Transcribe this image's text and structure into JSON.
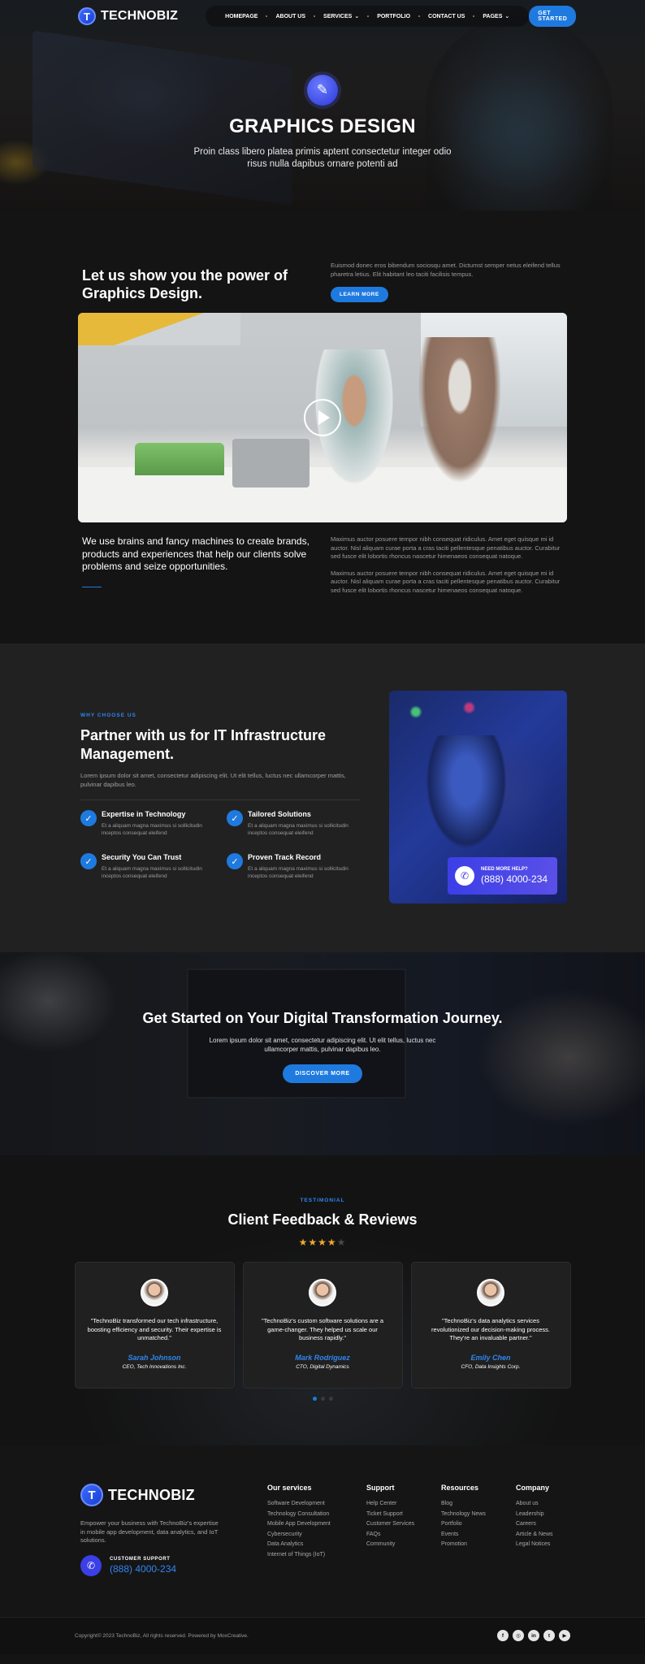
{
  "nav": {
    "logo_text": "TECHNOBIZ",
    "logo_mark": "T",
    "items": [
      {
        "label": "HOMEPAGE",
        "has_dropdown": false
      },
      {
        "label": "ABOUT US",
        "has_dropdown": false
      },
      {
        "label": "SERVICES",
        "has_dropdown": true
      },
      {
        "label": "PORTFOLIO",
        "has_dropdown": false
      },
      {
        "label": "CONTACT US",
        "has_dropdown": false
      },
      {
        "label": "PAGES",
        "has_dropdown": true
      }
    ],
    "cta": "GET STARTED"
  },
  "hero": {
    "icon": "design-tools-icon",
    "title": "GRAPHICS DESIGN",
    "subtitle": "Proin class libero platea primis aptent consectetur integer odio risus nulla dapibus ornare potenti ad"
  },
  "power": {
    "heading": "Let us show you the power of Graphics Design.",
    "intro": "Euismod donec eros bibendum sociosqu amet. Dictumst semper netus eleifend tellus pharetra letius. Elit habitant leo taciti facilisis tempus.",
    "button": "LEARN MORE",
    "lead": "We use brains and fancy machines to create brands, products and experiences that help our clients solve problems and seize opportunities.",
    "paragraphs": [
      "Maximus auctor posuere tempor nibh consequat ridiculus. Amet eget quisque mi id auctor. Nisl aliquam curae porta a cras taciti pellentesque penatibus auctor. Curabitur sed fusce elit lobortis rhoncus nascetur himenaeos consequat natoque.",
      "Maximus auctor posuere tempor nibh consequat ridiculus. Amet eget quisque mi id auctor. Nisl aliquam curae porta a cras taciti pellentesque penatibus auctor. Curabitur sed fusce elit lobortis rhoncus nascetur himenaeos consequat natoque."
    ]
  },
  "why": {
    "eyebrow": "WHY CHOOSE US",
    "title": "Partner with us for IT Infrastructure Management.",
    "description": "Lorem ipsum dolor sit amet, consectetur adipiscing elit. Ut elit tellus, luctus nec ullamcorper mattis, pulvinar dapibus leo.",
    "features": [
      {
        "title": "Expertise in Technology",
        "text": "Et a aliquam magna maximus si sollicitudin inceptos consequat eleifend"
      },
      {
        "title": "Tailored Solutions",
        "text": "Et a aliquam magna maximus si sollicitudin inceptos consequat eleifend"
      },
      {
        "title": "Security You Can Trust",
        "text": "Et a aliquam magna maximus si sollicitudin inceptos consequat eleifend"
      },
      {
        "title": "Proven Track Record",
        "text": "Et a aliquam magna maximus si sollicitudin inceptos consequat eleifend"
      }
    ],
    "help_label": "NEED MORE HELP?",
    "help_phone": "(888) 4000-234"
  },
  "cta": {
    "title": "Get Started on Your Digital Transformation Journey.",
    "description": "Lorem ipsum dolor sit amet, consectetur adipiscing elit. Ut elit tellus, luctus nec ullamcorper mattis, pulvinar dapibus leo.",
    "button": "DISCOVER MORE"
  },
  "testimonials": {
    "eyebrow": "TESTIMONIAL",
    "title": "Client Feedback & Reviews",
    "rating": 4,
    "rating_max": 5,
    "items": [
      {
        "quote": "\"TechnoBiz transformed our tech infrastructure, boosting efficiency and security. Their expertise is unmatched.\"",
        "name": "Sarah Johnson",
        "role": "CEO, Tech Innovations Inc."
      },
      {
        "quote": "\"TechnoBiz's custom software solutions are a game-changer. They helped us scale our business rapidly.\"",
        "name": "Mark Rodriguez",
        "role": "CTO, Digital Dynamics"
      },
      {
        "quote": "\"TechnoBiz's data analytics services revolutionized our decision-making process. They're an invaluable partner.\"",
        "name": "Emily Chen",
        "role": "CFO, Data Insights Corp."
      }
    ],
    "pagination_pages": 3,
    "pagination_active": 1
  },
  "footer": {
    "logo_text": "TECHNOBIZ",
    "about": "Empower your business with TechnoBiz's expertise in mobile app development, data analytics, and IoT solutions.",
    "support_label": "CUSTOMER SUPPORT",
    "support_phone": "(888) 4000-234",
    "columns": [
      {
        "title": "Our services",
        "links": [
          "Software Development",
          "Technology Consultation",
          "Mobile App Development",
          "Cybersecurity",
          "Data Analytics",
          "Internet of Things (IoT)"
        ]
      },
      {
        "title": "Support",
        "links": [
          "Help Center",
          "Ticket Support",
          "Customer Services",
          "FAQs",
          "Community"
        ]
      },
      {
        "title": "Resources",
        "links": [
          "Blog",
          "Technology News",
          "Portfolio",
          "Events",
          "Promotion"
        ]
      },
      {
        "title": "Company",
        "links": [
          "About us",
          "Leadership",
          "Careers",
          "Article & News",
          "Legal Notices"
        ]
      }
    ],
    "copyright": "Copyright© 2023 TechnoBiz, All rights reserved. Powered by MoxCreative.",
    "socials": [
      {
        "icon": "facebook-icon",
        "glyph": "f"
      },
      {
        "icon": "instagram-icon",
        "glyph": "◎"
      },
      {
        "icon": "linkedin-icon",
        "glyph": "in"
      },
      {
        "icon": "twitter-icon",
        "glyph": "t"
      },
      {
        "icon": "youtube-icon",
        "glyph": "▶"
      }
    ]
  },
  "colors": {
    "accent": "#1f7ae0",
    "purple": "#3b3fe6",
    "star": "#f0a830",
    "background": "#141414"
  }
}
